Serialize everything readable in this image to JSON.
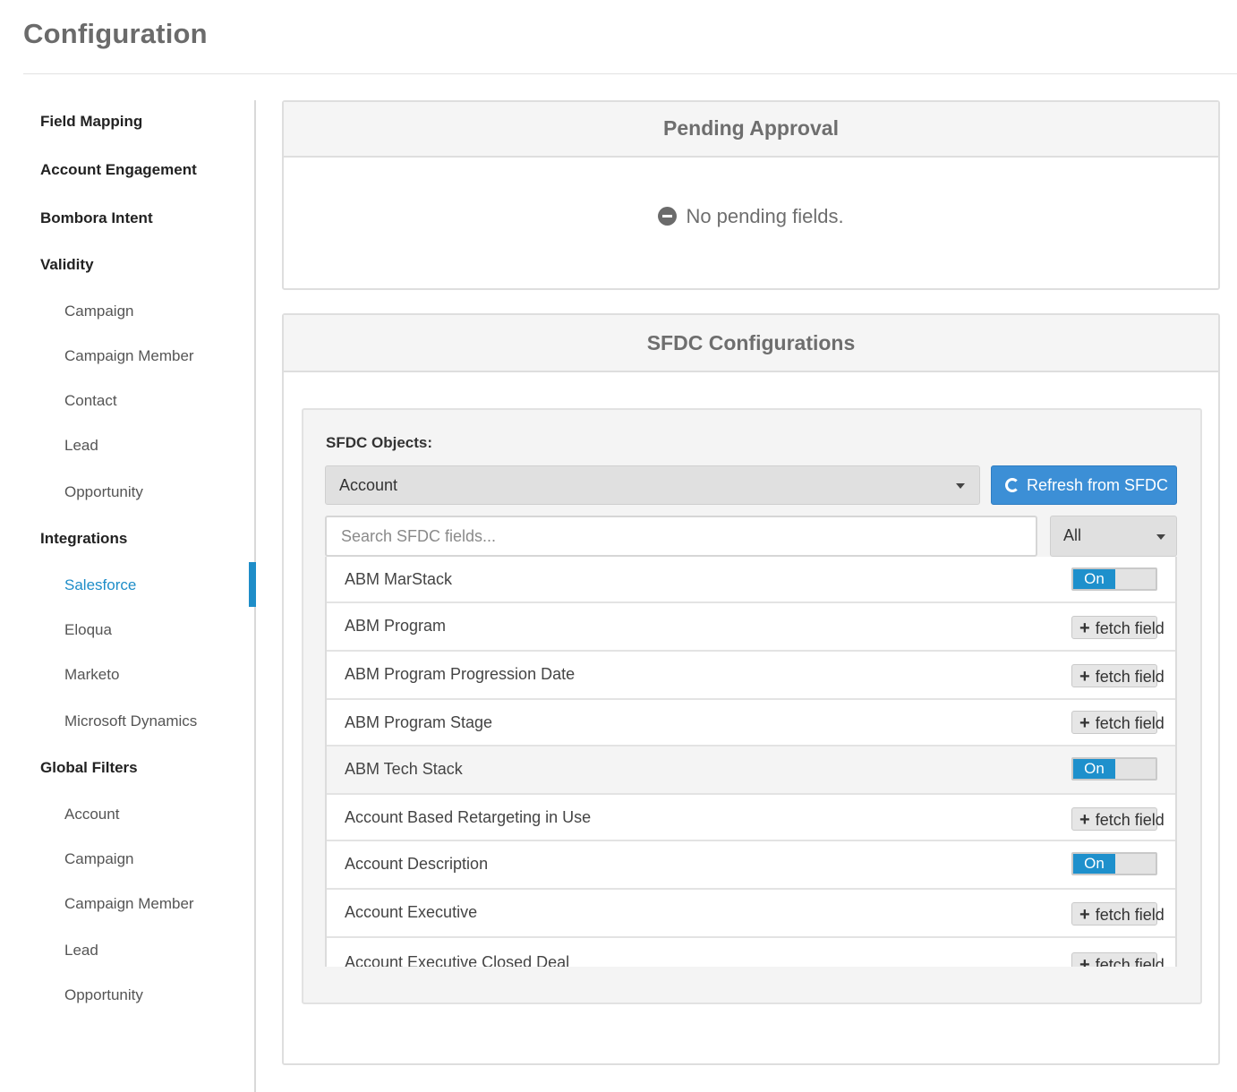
{
  "page": {
    "title": "Configuration"
  },
  "sidebar": {
    "items": [
      {
        "label": "Field Mapping",
        "type": "section"
      },
      {
        "label": "Account Engagement",
        "type": "section"
      },
      {
        "label": "Bombora Intent",
        "type": "section"
      },
      {
        "label": "Validity",
        "type": "section"
      },
      {
        "label": "Campaign",
        "type": "sub"
      },
      {
        "label": "Campaign Member",
        "type": "sub"
      },
      {
        "label": "Contact",
        "type": "sub"
      },
      {
        "label": "Lead",
        "type": "sub"
      },
      {
        "label": "Opportunity",
        "type": "sub"
      },
      {
        "label": "Integrations",
        "type": "section"
      },
      {
        "label": "Salesforce",
        "type": "sub",
        "active": true
      },
      {
        "label": "Eloqua",
        "type": "sub"
      },
      {
        "label": "Marketo",
        "type": "sub"
      },
      {
        "label": "Microsoft Dynamics",
        "type": "sub"
      },
      {
        "label": "Global Filters",
        "type": "section"
      },
      {
        "label": "Account",
        "type": "sub"
      },
      {
        "label": "Campaign",
        "type": "sub"
      },
      {
        "label": "Campaign Member",
        "type": "sub"
      },
      {
        "label": "Lead",
        "type": "sub"
      },
      {
        "label": "Opportunity",
        "type": "sub"
      }
    ],
    "active_color": "#1e8dc8"
  },
  "pending": {
    "title": "Pending Approval",
    "message": "No pending fields.",
    "icon": "minus-circle-icon"
  },
  "sfdc": {
    "title": "SFDC Configurations",
    "objects_label": "SFDC Objects:",
    "selected_object": "Account",
    "refresh_label": "Refresh from SFDC",
    "refresh_icon": "refresh-icon",
    "search_placeholder": "Search SFDC fields...",
    "search_value": "",
    "filter_value": "All",
    "accent_color": "#3c8fd6",
    "fields": [
      {
        "name": "ABM MarStack",
        "state": "on",
        "action_label": "On"
      },
      {
        "name": "ABM Program",
        "state": "fetch",
        "action_label": "fetch field"
      },
      {
        "name": "ABM Program Progression Date",
        "state": "fetch",
        "action_label": "fetch field"
      },
      {
        "name": "ABM Program Stage",
        "state": "fetch",
        "action_label": "fetch field"
      },
      {
        "name": "ABM Tech Stack",
        "state": "on",
        "action_label": "On"
      },
      {
        "name": "Account Based Retargeting in Use",
        "state": "fetch",
        "action_label": "fetch field"
      },
      {
        "name": "Account Description",
        "state": "on",
        "action_label": "On"
      },
      {
        "name": "Account Executive",
        "state": "fetch",
        "action_label": "fetch field"
      },
      {
        "name": "Account Executive Closed Deal",
        "state": "fetch",
        "action_label": "fetch field"
      }
    ]
  }
}
